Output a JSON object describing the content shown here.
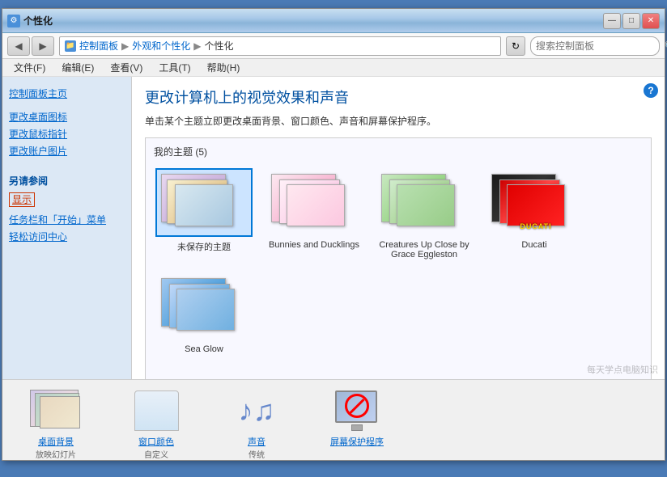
{
  "window": {
    "title": "个性化",
    "titlebar_icon": "⚙"
  },
  "addressbar": {
    "back_label": "◀",
    "forward_label": "▶",
    "breadcrumb": [
      {
        "label": "控制面板",
        "is_link": true
      },
      {
        "label": "外观和个性化",
        "is_link": true
      },
      {
        "label": "个性化",
        "is_link": false
      }
    ],
    "refresh_label": "↻",
    "search_placeholder": "搜索控制面板",
    "search_icon": "🔍"
  },
  "menubar": {
    "items": [
      {
        "label": "文件(F)"
      },
      {
        "label": "编辑(E)"
      },
      {
        "label": "查看(V)"
      },
      {
        "label": "工具(T)"
      },
      {
        "label": "帮助(H)"
      }
    ]
  },
  "sidebar": {
    "main_link": "控制面板主页",
    "links": [
      {
        "label": "更改桌面图标"
      },
      {
        "label": "更改鼠标指针"
      },
      {
        "label": "更改账户图片"
      }
    ],
    "also_section_title": "另请参阅",
    "also_links": [
      {
        "label": "显示",
        "boxed": true
      },
      {
        "label": "任务栏和「开始」菜单"
      },
      {
        "label": "轻松访问中心"
      }
    ]
  },
  "content": {
    "title": "更改计算机上的视觉效果和声音",
    "subtitle": "单击某个主题立即更改桌面背景、窗口颜色、声音和屏幕保护程序。",
    "themes_section_title": "我的主题 (5)",
    "themes": [
      {
        "id": "unsaved",
        "name": "未保存的主题",
        "selected": true,
        "type": "unsaved"
      },
      {
        "id": "bunnies",
        "name": "Bunnies and Ducklings",
        "selected": false,
        "type": "bunnies"
      },
      {
        "id": "creatures",
        "name": "Creatures Up Close by\nGrace Eggleston",
        "selected": false,
        "type": "creatures"
      },
      {
        "id": "ducati",
        "name": "Ducati",
        "selected": false,
        "type": "ducati"
      },
      {
        "id": "ocean",
        "name": "Sea Glow",
        "selected": false,
        "type": "ocean"
      }
    ]
  },
  "bottombar": {
    "items": [
      {
        "id": "desktop-bg",
        "label": "桌面背景",
        "sublabel": "放映幻灯片"
      },
      {
        "id": "window-color",
        "label": "窗口颜色",
        "sublabel": "自定义"
      },
      {
        "id": "sound",
        "label": "声音",
        "sublabel": "传统"
      },
      {
        "id": "screensaver",
        "label": "屏幕保护程序",
        "sublabel": ""
      }
    ]
  },
  "titlebar_controls": {
    "minimize": "—",
    "maximize": "□",
    "close": "✕"
  }
}
